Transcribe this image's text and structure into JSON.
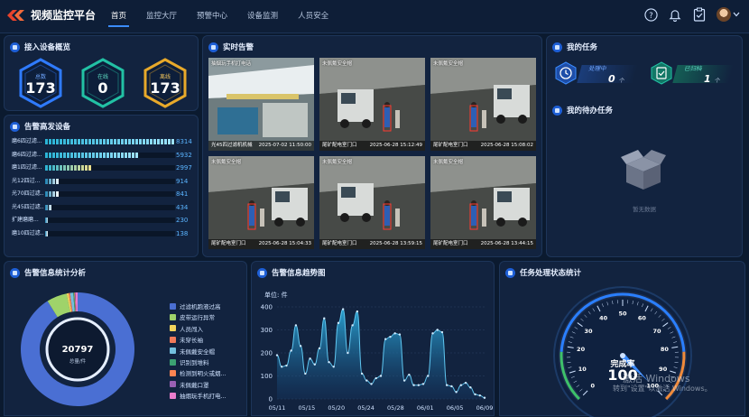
{
  "app": {
    "title": "视频监控平台"
  },
  "nav": {
    "items": [
      {
        "label": "首页",
        "active": true
      },
      {
        "label": "监控大厅"
      },
      {
        "label": "预警中心"
      },
      {
        "label": "设备监测"
      },
      {
        "label": "人员安全"
      }
    ]
  },
  "top_icons": [
    "help-icon",
    "bell-icon",
    "clipboard-check-icon",
    "avatar",
    "chevron-down-icon"
  ],
  "device_overview": {
    "title": "接入设备概览",
    "items": [
      {
        "label": "总数",
        "value": "173",
        "color": "#2f7bff"
      },
      {
        "label": "在线",
        "value": "0",
        "color": "#22c1a4"
      },
      {
        "label": "离线",
        "value": "173",
        "color": "#e8a92a"
      }
    ]
  },
  "alarm_devices": {
    "title": "告警高发设备",
    "rows": [
      {
        "name": "磨6四过滤...",
        "value": 8314,
        "display": "8314"
      },
      {
        "name": "磨6四过滤...",
        "value": 5932,
        "display": "5932"
      },
      {
        "name": "磨1四过滤...",
        "value": 2997,
        "display": "2997"
      },
      {
        "name": "光12四过...",
        "value": 914,
        "display": "914"
      },
      {
        "name": "光70四过滤...",
        "value": 841,
        "display": "841"
      },
      {
        "name": "光45四过滤...",
        "value": 434,
        "display": "434"
      },
      {
        "name": "扩建磨磨...",
        "value": 230,
        "display": "230"
      },
      {
        "name": "磨10四过滤...",
        "value": 138,
        "display": "138"
      }
    ]
  },
  "realtime_alarms": {
    "title": "实时告警",
    "cams": [
      {
        "label": "抽烟玩手机打电话",
        "location": "光45四过滤机机械",
        "time": "2025-07-02 11:50:00"
      },
      {
        "label": "未佩戴安全帽",
        "location": "尾矿配电室门口",
        "time": "2025-06-28 15:12:49"
      },
      {
        "label": "未佩戴安全帽",
        "location": "尾矿配电室门口",
        "time": "2025-06-28 15:08:02"
      },
      {
        "label": "未佩戴安全帽",
        "location": "尾矿配电室门口",
        "time": "2025-06-28 15:04:33"
      },
      {
        "label": "未佩戴安全帽",
        "location": "尾矿配电室门口",
        "time": "2025-06-28 13:59:15"
      },
      {
        "label": "未佩戴安全帽",
        "location": "尾矿配电室门口",
        "time": "2025-06-28 13:44:15"
      }
    ]
  },
  "my_tasks": {
    "title": "我的任务",
    "items": [
      {
        "label": "处理中",
        "value": "0",
        "unit": "个",
        "color": "#2f7bff"
      },
      {
        "label": "已归档",
        "value": "1",
        "unit": "个",
        "color": "#22c1a4"
      }
    ]
  },
  "my_todo": {
    "title": "我的待办任务",
    "empty_text": "暂无数据"
  },
  "alarm_stats": {
    "title": "告警信息统计分析",
    "total": "20797",
    "total_label": "总量/件",
    "legend": [
      {
        "label": "过滤机跑液过高",
        "color": "#4a6fd3"
      },
      {
        "label": "皮带运行异常",
        "color": "#9fd36a"
      },
      {
        "label": "人员闯入",
        "color": "#f2d45c"
      },
      {
        "label": "未穿长袖",
        "color": "#f07a5a"
      },
      {
        "label": "未佩戴安全帽",
        "color": "#73c0de"
      },
      {
        "label": "识别到堆料",
        "color": "#3ba272"
      },
      {
        "label": "检测到明火或烟...",
        "color": "#fc8452"
      },
      {
        "label": "未佩戴口罩",
        "color": "#9a60b4"
      },
      {
        "label": "抽烟玩手机打电...",
        "color": "#ea7ccc"
      }
    ],
    "values": [
      18950,
      1200,
      120,
      90,
      180,
      60,
      40,
      30,
      127
    ]
  },
  "trend": {
    "title": "告警信息趋势图",
    "unit_label": "单位: 件"
  },
  "chart_data": {
    "type": "area",
    "ylabel": "单位: 件",
    "ylim": [
      0,
      400
    ],
    "yticks": [
      0,
      100,
      200,
      300,
      400
    ],
    "x_tick_labels": [
      "05/11",
      "05/15",
      "05/20",
      "05/24",
      "05/28",
      "06/01",
      "06/05",
      "06/09"
    ],
    "series": [
      {
        "values": [
          190,
          140,
          145,
          210,
          320,
          230,
          110,
          175,
          150,
          220,
          350,
          160,
          140,
          330,
          390,
          200,
          320,
          380,
          110,
          80,
          65,
          90,
          100,
          260,
          270,
          285,
          280,
          80,
          105,
          60,
          60,
          65,
          100,
          285,
          300,
          290,
          60,
          55,
          30,
          60,
          70,
          50,
          20,
          15,
          5
        ]
      }
    ]
  },
  "task_status": {
    "title": "任务处理状态统计",
    "gauge_label": "完成率",
    "gauge_value": "100",
    "gauge_ticks": [
      "0",
      "10",
      "20",
      "30",
      "40",
      "50",
      "60",
      "70",
      "80",
      "90",
      "100"
    ],
    "completion_rate": 100
  },
  "watermark": {
    "line1": "激活 Windows",
    "line2": "转到\"设置\"以激活 Windows。"
  }
}
